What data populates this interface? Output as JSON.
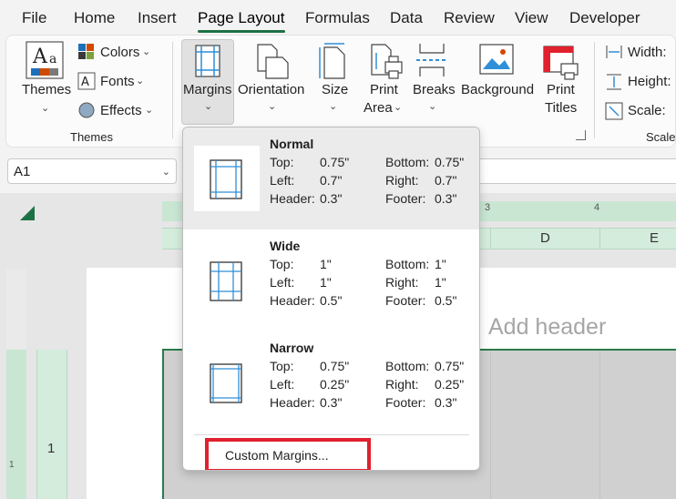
{
  "menubar": {
    "tabs": [
      {
        "label": "File"
      },
      {
        "label": "Home"
      },
      {
        "label": "Insert"
      },
      {
        "label": "Page Layout"
      },
      {
        "label": "Formulas"
      },
      {
        "label": "Data"
      },
      {
        "label": "Review"
      },
      {
        "label": "View"
      },
      {
        "label": "Developer"
      }
    ],
    "active": "Page Layout"
  },
  "ribbon": {
    "themes_group": {
      "themes_label": "Themes",
      "colors_label": "Colors",
      "fonts_label": "Fonts",
      "effects_label": "Effects",
      "group_label": "Themes"
    },
    "page_setup": {
      "margins_label": "Margins",
      "orientation_label": "Orientation",
      "size_label": "Size",
      "print_area_label_1": "Print",
      "print_area_label_2": "Area",
      "breaks_label": "Breaks",
      "background_label": "Background",
      "print_titles_label_1": "Print",
      "print_titles_label_2": "Titles"
    },
    "scale_group": {
      "width_label": "Width:",
      "height_label": "Height:",
      "scale_label": "Scale:",
      "group_label": "Scale"
    }
  },
  "namebox": {
    "value": "A1"
  },
  "sheet": {
    "ruler_labels": [
      "3",
      "4"
    ],
    "columns": [
      "D",
      "E"
    ],
    "row_numbers": [
      "1"
    ],
    "vertical_ruler_label": "1",
    "add_header_placeholder": "Add header"
  },
  "dropdown": {
    "options": [
      {
        "name": "Normal",
        "top_label": "Top:",
        "top": "0.75\"",
        "bottom_label": "Bottom:",
        "bottom": "0.75\"",
        "left_label": "Left:",
        "left": "0.7\"",
        "right_label": "Right:",
        "right": "0.7\"",
        "header_label": "Header:",
        "header": "0.3\"",
        "footer_label": "Footer:",
        "footer": "0.3\""
      },
      {
        "name": "Wide",
        "top_label": "Top:",
        "top": "1\"",
        "bottom_label": "Bottom:",
        "bottom": "1\"",
        "left_label": "Left:",
        "left": "1\"",
        "right_label": "Right:",
        "right": "1\"",
        "header_label": "Header:",
        "header": "0.5\"",
        "footer_label": "Footer:",
        "footer": "0.5\""
      },
      {
        "name": "Narrow",
        "top_label": "Top:",
        "top": "0.75\"",
        "bottom_label": "Bottom:",
        "bottom": "0.75\"",
        "left_label": "Left:",
        "left": "0.25\"",
        "right_label": "Right:",
        "right": "0.25\"",
        "header_label": "Header:",
        "header": "0.3\"",
        "footer_label": "Footer:",
        "footer": "0.3\""
      }
    ],
    "selected": "Normal",
    "custom_label": "Custom Margins..."
  },
  "colors": {
    "accent_green": "#1e7145",
    "highlight_red": "#e0212e",
    "icon_blue": "#2f8fd8"
  }
}
